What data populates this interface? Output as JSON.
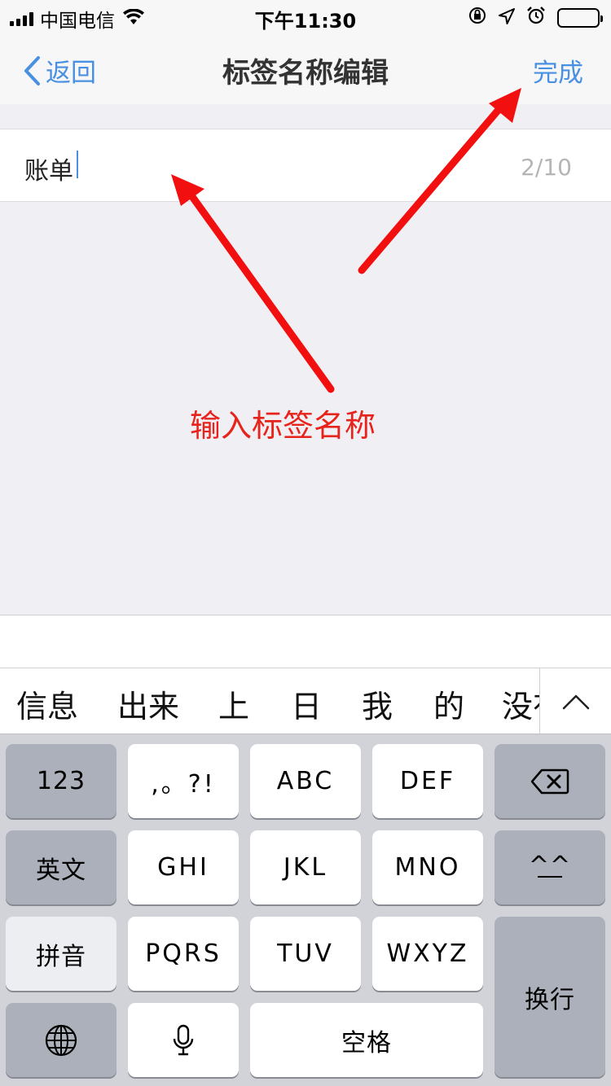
{
  "status_bar": {
    "carrier": "中国电信",
    "time": "下午11:30",
    "icons": [
      "signal-icon",
      "wifi-icon",
      "orientation-lock-icon",
      "location-icon",
      "alarm-icon",
      "battery-icon"
    ]
  },
  "nav": {
    "back_label": "返回",
    "title": "标签名称编辑",
    "done_label": "完成"
  },
  "input": {
    "value": "账单",
    "counter": "2/10"
  },
  "annotation": {
    "text": "输入标签名称",
    "color": "#e8231b"
  },
  "candidates": [
    "信息",
    "出来",
    "上",
    "日",
    "我",
    "的",
    "没有"
  ],
  "keyboard": {
    "row1": [
      "123",
      ",。?!",
      "ABC",
      "DEF"
    ],
    "row2": [
      "英文",
      "GHI",
      "JKL",
      "MNO",
      "^^"
    ],
    "row3": [
      "拼音",
      "PQRS",
      "TUV",
      "WXYZ"
    ],
    "return_label": "换行",
    "space_label": "空格"
  },
  "colors": {
    "accent": "#4a90e2",
    "background": "#efeff4",
    "keyboard_bg": "#d1d3d9"
  }
}
